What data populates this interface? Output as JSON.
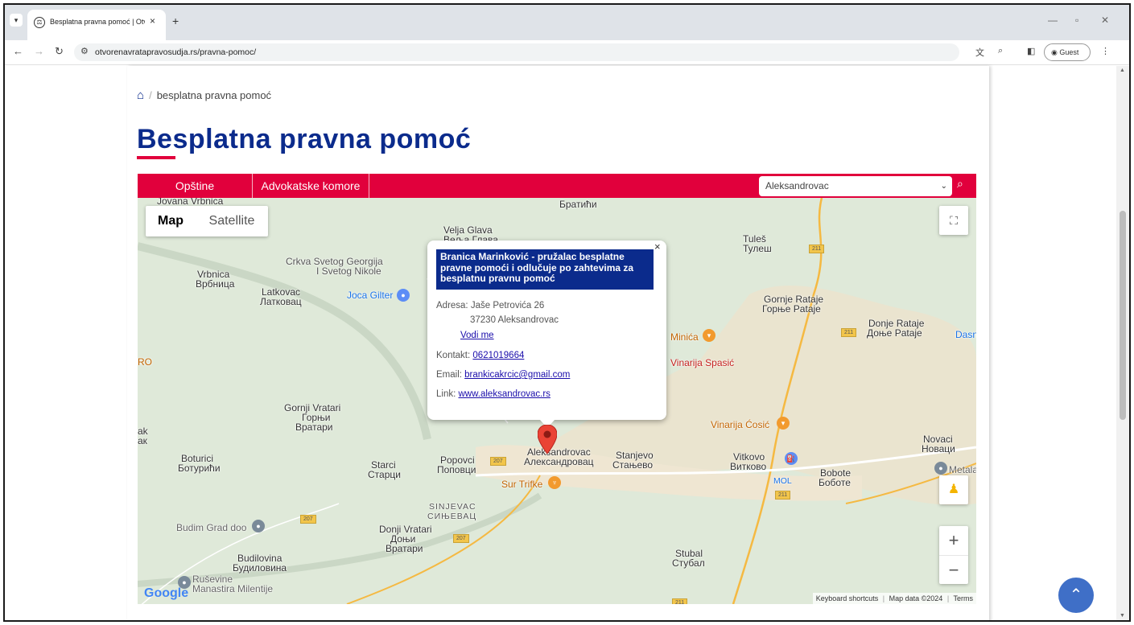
{
  "browser": {
    "tab_title": "Besplatna pravna pomoć | Otvo",
    "tab_close": "×",
    "new_tab": "+",
    "url": "otvorenavratapravosudja.rs/pravna-pomoc/",
    "guest_label": "Guest"
  },
  "breadcrumb": {
    "current": "besplatna pravna pomoć"
  },
  "page": {
    "title": "Besplatna pravna pomoć"
  },
  "tabs": [
    {
      "label": "Opštine"
    },
    {
      "label": "Advokatske komore"
    }
  ],
  "select": {
    "value": "Aleksandrovac"
  },
  "map": {
    "type_map": "Map",
    "type_satellite": "Satellite",
    "footer": {
      "shortcuts": "Keyboard shortcuts",
      "map_data": "Map data ©2024",
      "terms": "Terms"
    },
    "google": "Google",
    "labels": {
      "jovana_vrbnica": "Jovana Vrbnica",
      "bratichi": "Братићи",
      "velja_glava": "Velja Glava",
      "velja_glava_cyr": "Веља Глава",
      "tules": "Tuleš",
      "tules_cyr": "Тулеш",
      "crkva_1": "Crkva Svetog Georgija",
      "crkva_2": "I Svetog Nikole",
      "vrbnica": "Vrbnica",
      "vrbnica_cyr": "Врбница",
      "latkovac": "Latkovac",
      "latkovac_cyr": "Латковац",
      "joca_gilter": "Joca Gilter",
      "gornje_rataje": "Gornje Rataje",
      "gornje_rataje_cyr": "Горње Рataje",
      "donje_rataje": "Donje Rataje",
      "donje_rataje_cyr": "Доње Рataje",
      "dasn": "Dasn",
      "minica": "Minića",
      "vinarija_spasic": "Vinarija Spasić",
      "ro": "RO",
      "gornji_vratari": "Gornji Vratari",
      "gornji_vratari_cyr1": "Горњи",
      "gornji_vratari_cyr2": "Вратари",
      "vinarija_cosic": "Vinarija Ćosić",
      "ak1": "ak",
      "ak2": "aк",
      "novaci": "Novaci",
      "novaci_cyr": "Новаци",
      "boturici": "Boturici",
      "boturici_cyr": "Ботурићи",
      "starci": "Starci",
      "starci_cyr": "Старци",
      "popovci": "Popovci",
      "popovci_cyr": "Поповци",
      "aleksandrovac": "Aleksandrovac",
      "aleksandrovac_cyr": "Александровац",
      "stanjevo": "Stanjevo",
      "stanjevo_cyr": "Стањево",
      "vitkovo": "Vitkovo",
      "vitkovo_cyr": "Витково",
      "bobote": "Bobote",
      "bobote_cyr": "Боботе",
      "mol": "MOL",
      "metala": "Metala",
      "sur_trifke": "Sur Trifke",
      "sinjevac": "SINJEVAC",
      "sinjevac_cyr": "СИЊЕВАЦ",
      "budim_grad": "Budim Grad doo",
      "donji_vratari": "Donji Vratari",
      "donji_vratari_cyr1": "Доњи",
      "donji_vratari_cyr2": "Вратари",
      "budilovina": "Budilovina",
      "budilovina_cyr": "Будиловина",
      "stubal": "Stubal",
      "stubal_cyr": "Стубал",
      "rusevine_1": "Ruševine",
      "rusevine_2": "Manastira Milentije",
      "road_211": "211",
      "road_207": "207"
    },
    "info_window": {
      "heading": "Branica Marinković - pružalac besplatne pravne pomoći i odlučuje po zahtevima za besplatnu pravnu pomoć",
      "address_label": "Adresa:",
      "address_line1": "Jaše Petrovića 26",
      "address_line2": "37230 Aleksandrovac",
      "directions": "Vodi me",
      "contact_label": "Kontakt:",
      "contact_value": "0621019664",
      "email_label": "Email:",
      "email_value": "brankicakrcic@gmail.com",
      "link_label": "Link:",
      "link_value": "www.aleksandrovac.rs",
      "close": "×"
    }
  },
  "colors": {
    "brand_blue": "#0b2b8c",
    "brand_red": "#e1003c",
    "back_to_top": "#3f6fc7"
  }
}
